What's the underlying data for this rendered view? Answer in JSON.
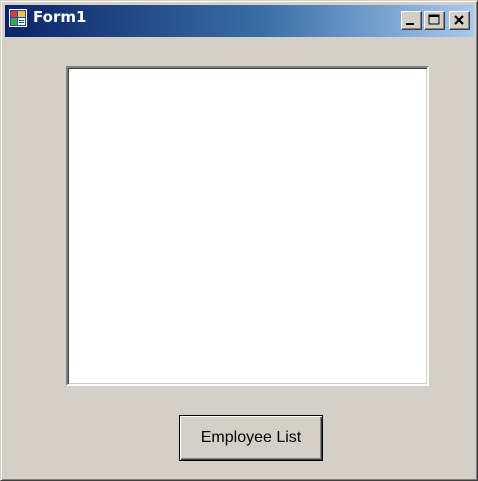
{
  "window": {
    "title": "Form1",
    "icon": "form-app-icon",
    "caption_buttons": {
      "minimize": "minimize-icon",
      "maximize": "maximize-icon",
      "close": "close-icon"
    }
  },
  "main": {
    "listbox_items": [],
    "employee_button_label": "Employee List"
  },
  "colors": {
    "face": "#d4d0c8",
    "title_start": "#0a246a",
    "title_end": "#a6caf0",
    "listbox_bg": "#ffffff"
  }
}
